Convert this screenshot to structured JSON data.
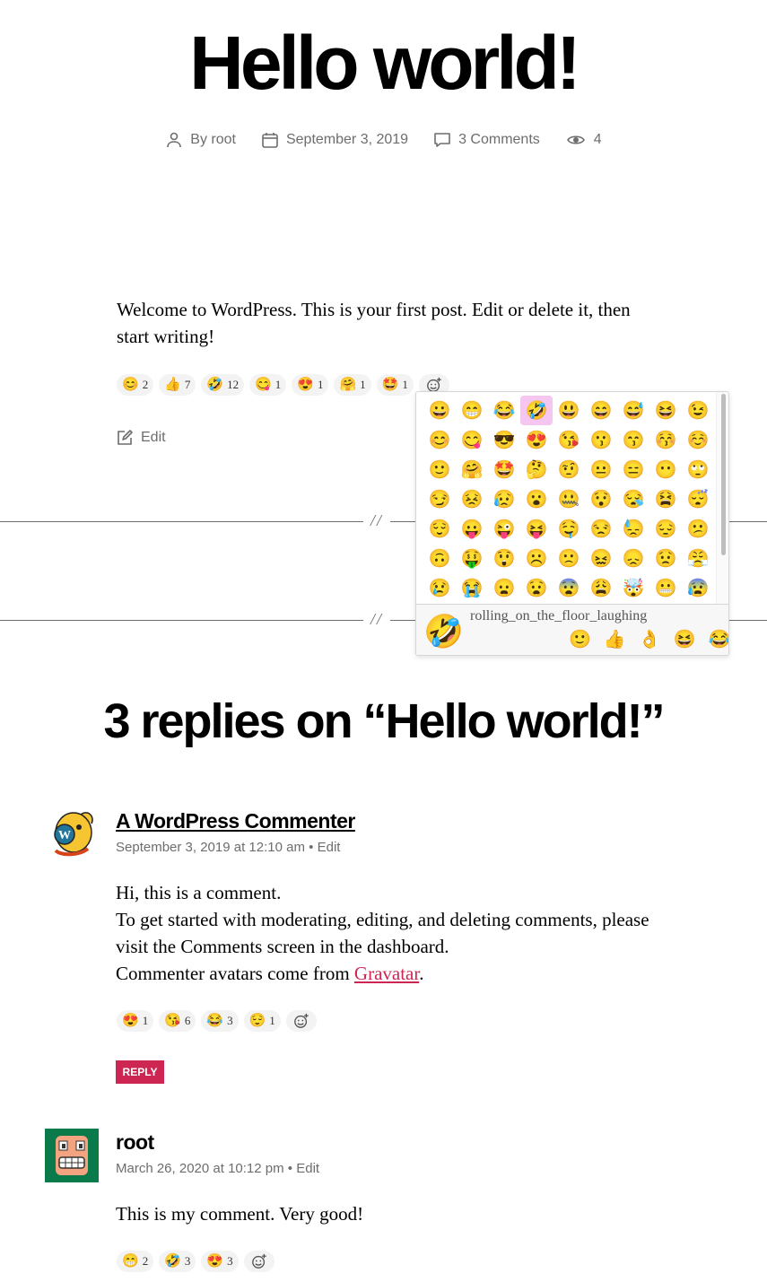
{
  "post": {
    "title": "Hello world!",
    "meta": {
      "author": "By root",
      "date": "September 3, 2019",
      "comments": "3 Comments",
      "views": "4"
    },
    "content": "Welcome to WordPress. This is your first post. Edit or delete it, then start writing!",
    "reactions": [
      {
        "emoji": "😊",
        "count": "2"
      },
      {
        "emoji": "👍",
        "count": "7"
      },
      {
        "emoji": "🤣",
        "count": "12"
      },
      {
        "emoji": "😋",
        "count": "1"
      },
      {
        "emoji": "😍",
        "count": "1"
      },
      {
        "emoji": "🤗",
        "count": "1"
      },
      {
        "emoji": "🤩",
        "count": "1"
      }
    ],
    "edit_label": "Edit"
  },
  "separator_mark": "//",
  "emoji_picker": {
    "grid": [
      "😀",
      "😁",
      "😂",
      "🤣",
      "😃",
      "😄",
      "😅",
      "😆",
      "😉",
      "😊",
      "😋",
      "😎",
      "😍",
      "😘",
      "😗",
      "😙",
      "😚",
      "☺️",
      "🙂",
      "🤗",
      "🤩",
      "🤔",
      "🤨",
      "😐",
      "😑",
      "😶",
      "🙄",
      "😏",
      "😣",
      "😥",
      "😮",
      "🤐",
      "😯",
      "😪",
      "😫",
      "😴",
      "😌",
      "😛",
      "😜",
      "😝",
      "🤤",
      "😒",
      "😓",
      "😔",
      "😕",
      "🙃",
      "🤑",
      "😲",
      "☹️",
      "🙁",
      "😖",
      "😞",
      "😟",
      "😤",
      "😢",
      "😭",
      "😦",
      "😧",
      "😨",
      "😩",
      "🤯",
      "😬",
      "😰"
    ],
    "selected_index": 3,
    "preview_emoji": "🤣",
    "preview_name": "rolling_on_the_floor_laughing",
    "quick": [
      "🙂",
      "👍",
      "👌",
      "😆",
      "😂"
    ]
  },
  "replies_title": "3 replies on “Hello world!”",
  "comments": [
    {
      "author": "A WordPress Commenter",
      "date": "September 3, 2019 at 12:10 am",
      "edit": "Edit",
      "lines": [
        "Hi, this is a comment.",
        "To get started with moderating, editing, and deleting comments, please visit the Comments screen in the dashboard.",
        "Commenter avatars come from "
      ],
      "link_text": "Gravatar",
      "link_after": ".",
      "reactions": [
        {
          "emoji": "😍",
          "count": "1"
        },
        {
          "emoji": "😘",
          "count": "6"
        },
        {
          "emoji": "😂",
          "count": "3"
        },
        {
          "emoji": "😌",
          "count": "1"
        }
      ],
      "reply_label": "REPLY"
    },
    {
      "author": "root",
      "date": "March 26, 2020 at 10:12 pm",
      "edit": "Edit",
      "text": "This is my comment. Very good!",
      "reactions": [
        {
          "emoji": "😁",
          "count": "2"
        },
        {
          "emoji": "🤣",
          "count": "3"
        },
        {
          "emoji": "😍",
          "count": "3"
        }
      ]
    }
  ],
  "colors": {
    "accent": "#cd2653",
    "meta_gray": "#6d6d6d",
    "picker_highlight": "#f5c6f0",
    "avatar_bg": "#0a7a4a"
  }
}
